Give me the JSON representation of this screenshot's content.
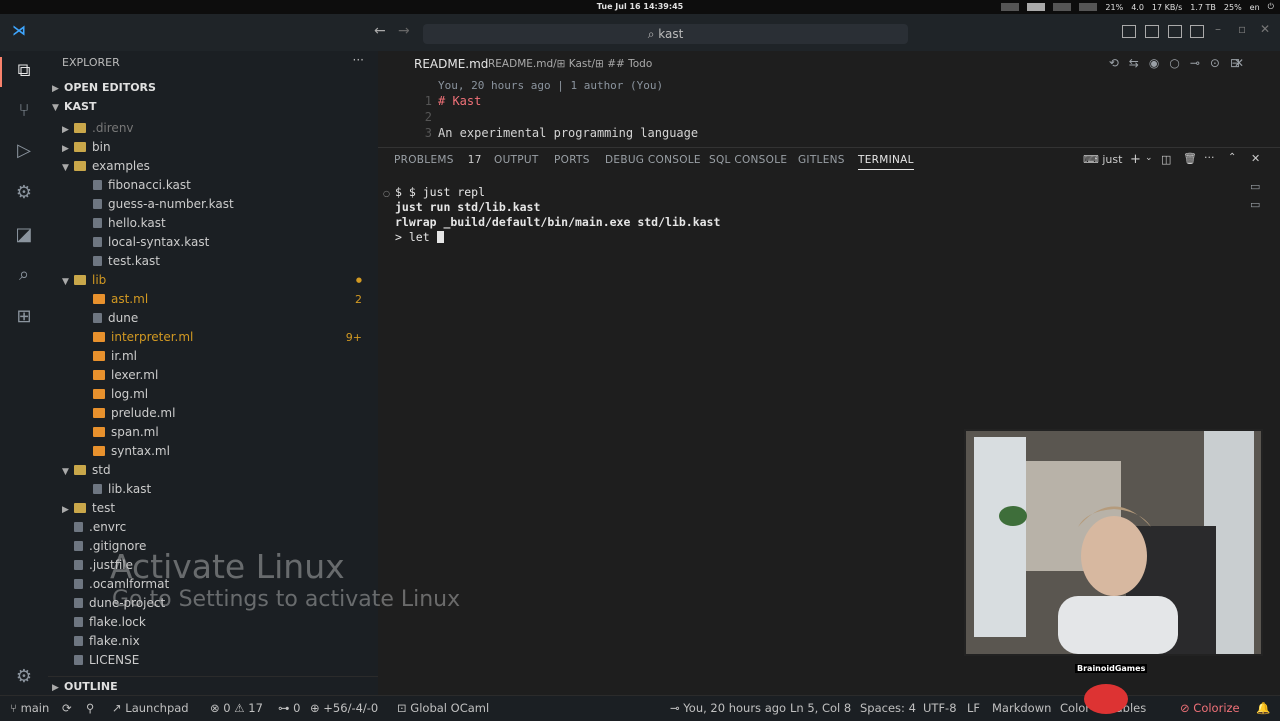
{
  "system_bar": {
    "clock": "Tue Jul 16 14:39:45",
    "tray": [
      "21%",
      "4.0",
      "17 KB/s",
      "1.7 TB",
      "25%",
      "en"
    ]
  },
  "title_bar": {
    "search": "kast"
  },
  "explorer": {
    "title": "EXPLORER",
    "open_editors": "OPEN EDITORS",
    "root": "KAST",
    "items": [
      {
        "label": ".direnv",
        "kind": "folder",
        "depth": 1,
        "expanded": false,
        "dim": true
      },
      {
        "label": "bin",
        "kind": "folder",
        "depth": 1,
        "expanded": false
      },
      {
        "label": "examples",
        "kind": "folder",
        "depth": 1,
        "expanded": true
      },
      {
        "label": "fibonacci.kast",
        "kind": "file",
        "depth": 2
      },
      {
        "label": "guess-a-number.kast",
        "kind": "file",
        "depth": 2
      },
      {
        "label": "hello.kast",
        "kind": "file",
        "depth": 2
      },
      {
        "label": "local-syntax.kast",
        "kind": "file",
        "depth": 2
      },
      {
        "label": "test.kast",
        "kind": "file",
        "depth": 2
      },
      {
        "label": "lib",
        "kind": "folder",
        "depth": 1,
        "expanded": true,
        "modified": true
      },
      {
        "label": "ast.ml",
        "kind": "ml",
        "depth": 2,
        "badge": "2",
        "modified": true
      },
      {
        "label": "dune",
        "kind": "file",
        "depth": 2
      },
      {
        "label": "interpreter.ml",
        "kind": "ml",
        "depth": 2,
        "badge": "9+",
        "modified": true
      },
      {
        "label": "ir.ml",
        "kind": "ml",
        "depth": 2
      },
      {
        "label": "lexer.ml",
        "kind": "ml",
        "depth": 2
      },
      {
        "label": "log.ml",
        "kind": "ml",
        "depth": 2
      },
      {
        "label": "prelude.ml",
        "kind": "ml",
        "depth": 2
      },
      {
        "label": "span.ml",
        "kind": "ml",
        "depth": 2
      },
      {
        "label": "syntax.ml",
        "kind": "ml",
        "depth": 2
      },
      {
        "label": "std",
        "kind": "folder",
        "depth": 1,
        "expanded": true
      },
      {
        "label": "lib.kast",
        "kind": "file",
        "depth": 2
      },
      {
        "label": "test",
        "kind": "folder",
        "depth": 1,
        "expanded": false
      },
      {
        "label": ".envrc",
        "kind": "file",
        "depth": 1
      },
      {
        "label": ".gitignore",
        "kind": "file",
        "depth": 1
      },
      {
        "label": ".justfile",
        "kind": "file",
        "depth": 1
      },
      {
        "label": ".ocamlformat",
        "kind": "file",
        "depth": 1
      },
      {
        "label": "dune-project",
        "kind": "file",
        "depth": 1
      },
      {
        "label": "flake.lock",
        "kind": "file",
        "depth": 1
      },
      {
        "label": "flake.nix",
        "kind": "file",
        "depth": 1
      },
      {
        "label": "LICENSE",
        "kind": "file",
        "depth": 1
      }
    ],
    "outline": "OUTLINE"
  },
  "editor": {
    "tab": "README.md",
    "breadcrumb": "README.md/⊞ Kast/⊞ ## Todo",
    "blame": "You, 20 hours ago | 1 author (You)",
    "lines": [
      {
        "num": "1",
        "text": "# Kast"
      },
      {
        "num": "2",
        "text": ""
      },
      {
        "num": "3",
        "text": "An experimental programming language"
      }
    ]
  },
  "panel": {
    "tabs": [
      {
        "label": "PROBLEMS",
        "badge": "17"
      },
      {
        "label": "OUTPUT"
      },
      {
        "label": "PORTS"
      },
      {
        "label": "DEBUG CONSOLE"
      },
      {
        "label": "SQL CONSOLE"
      },
      {
        "label": "GITLENS"
      },
      {
        "label": "TERMINAL",
        "active": true
      }
    ],
    "terminal_name": "just",
    "terminal_lines": [
      "$ just repl",
      "just run std/lib.kast",
      "rlwrap _build/default/bin/main.exe std/lib.kast",
      "> let "
    ]
  },
  "watermark": {
    "line1": "Activate Linux",
    "line2": "Go to Settings to activate Linux"
  },
  "webcam": {
    "caption": "BrainoidGames"
  },
  "status_bar": {
    "branch": "main",
    "launchpad": "Launchpad",
    "errors": "0",
    "warnings": "17",
    "ports": "0",
    "diff": "+56/-4/-0",
    "ocaml": "Global OCaml",
    "blame": "You, 20 hours ago",
    "position": "Ln 5, Col 8",
    "spaces": "Spaces: 4",
    "encoding": "UTF-8",
    "eol": "LF",
    "language": "Markdown",
    "colors": "Color Variables",
    "colorize": "Colorize"
  },
  "colors": {
    "accent": "#007acc",
    "heading": "#f07178",
    "ml_icon": "#e8912d",
    "modified": "#d29922"
  }
}
